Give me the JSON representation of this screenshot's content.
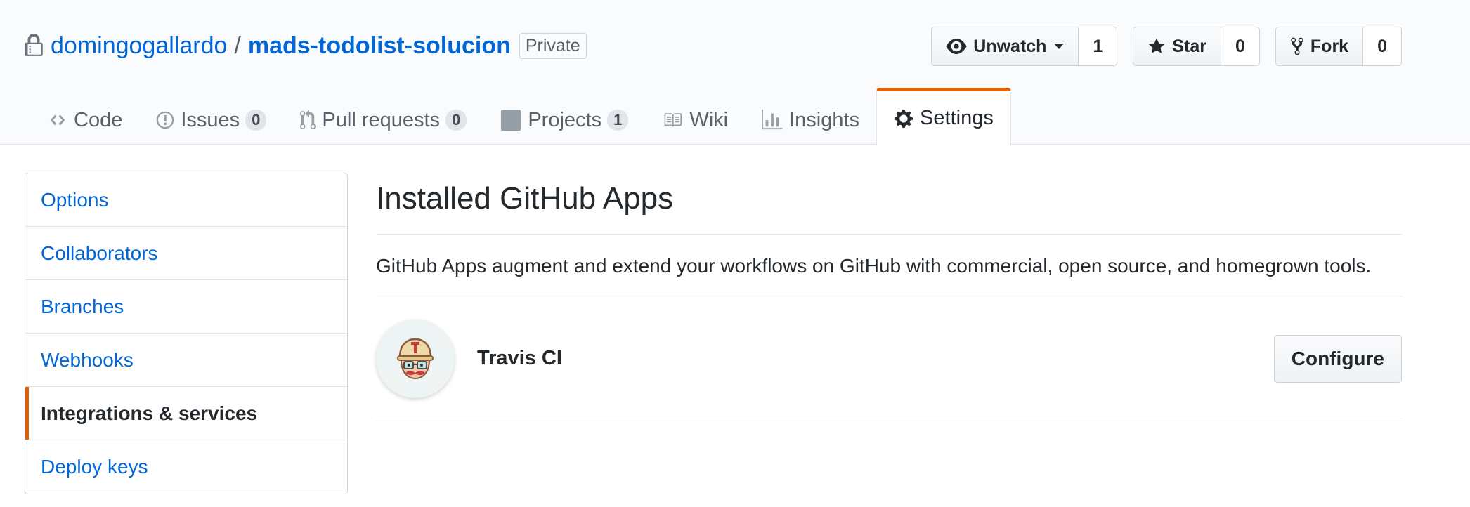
{
  "repo": {
    "owner": "domingogallardo",
    "separator": "/",
    "name": "mads-todolist-solucion",
    "visibility": "Private"
  },
  "actions": {
    "watch": {
      "label": "Unwatch",
      "count": "1"
    },
    "star": {
      "label": "Star",
      "count": "0"
    },
    "fork": {
      "label": "Fork",
      "count": "0"
    }
  },
  "tabs": [
    {
      "label": "Code",
      "icon": "code-icon"
    },
    {
      "label": "Issues",
      "icon": "issue-icon",
      "count": "0"
    },
    {
      "label": "Pull requests",
      "icon": "pull-request-icon",
      "count": "0"
    },
    {
      "label": "Projects",
      "icon": "project-icon",
      "count": "1"
    },
    {
      "label": "Wiki",
      "icon": "book-icon"
    },
    {
      "label": "Insights",
      "icon": "graph-icon"
    },
    {
      "label": "Settings",
      "icon": "gear-icon",
      "selected": true
    }
  ],
  "sidebar": {
    "items": [
      {
        "label": "Options"
      },
      {
        "label": "Collaborators"
      },
      {
        "label": "Branches"
      },
      {
        "label": "Webhooks"
      },
      {
        "label": "Integrations & services",
        "selected": true
      },
      {
        "label": "Deploy keys"
      }
    ]
  },
  "main": {
    "title": "Installed GitHub Apps",
    "description": "GitHub Apps augment and extend your workflows on GitHub with commercial, open source, and homegrown tools.",
    "apps": [
      {
        "name": "Travis CI",
        "icon": "travis-ci-mascot-icon",
        "action_label": "Configure"
      }
    ]
  },
  "colors": {
    "link": "#0366d6",
    "text": "#24292e",
    "muted": "#586069",
    "selected_accent": "#e36209",
    "header_bg": "#fafbfc",
    "border": "#e1e4e8"
  }
}
